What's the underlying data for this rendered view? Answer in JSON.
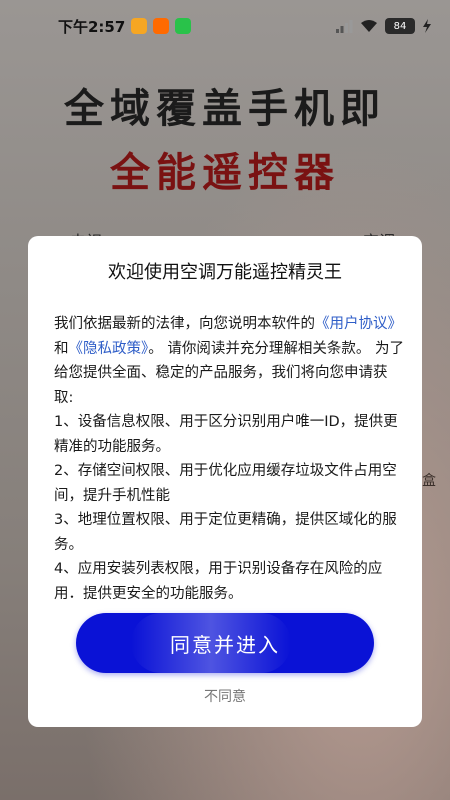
{
  "status_bar": {
    "time": "下午2:57",
    "battery": "84"
  },
  "background": {
    "headline_line1": "全域覆盖手机即",
    "headline_line2": "全能遥控器",
    "side_left": "电视",
    "side_right": "空调",
    "side_label_right": "盒"
  },
  "dialog": {
    "title": "欢迎使用空调万能遥控精灵王",
    "intro_prefix": "我们依据最新的法律，向您说明本软件的",
    "user_agreement_link": "《用户协议》",
    "and_text": "和",
    "privacy_policy_link": "《隐私政策》",
    "intro_suffix": "。 请你阅读并充分理解相关条款。 为了给您提供全面、稳定的产品服务，我们将向您申请获取:",
    "items": [
      "1、设备信息权限、用于区分识别用户唯一ID，提供更精准的功能服务。",
      "2、存储空间权限、用于优化应用缓存垃圾文件占用空间，提升手机性能",
      "3、地理位置权限、用于定位更精确，提供区域化的服务。",
      "4、应用安装列表权限，用于识别设备存在风险的应用．提供更安全的功能服务。"
    ],
    "agree_button": "同意并进入",
    "disagree_link": "不同意"
  },
  "colors": {
    "agree_button": "#0a12d6",
    "link": "#2f5ec8",
    "headline_red": "#7a1212"
  }
}
